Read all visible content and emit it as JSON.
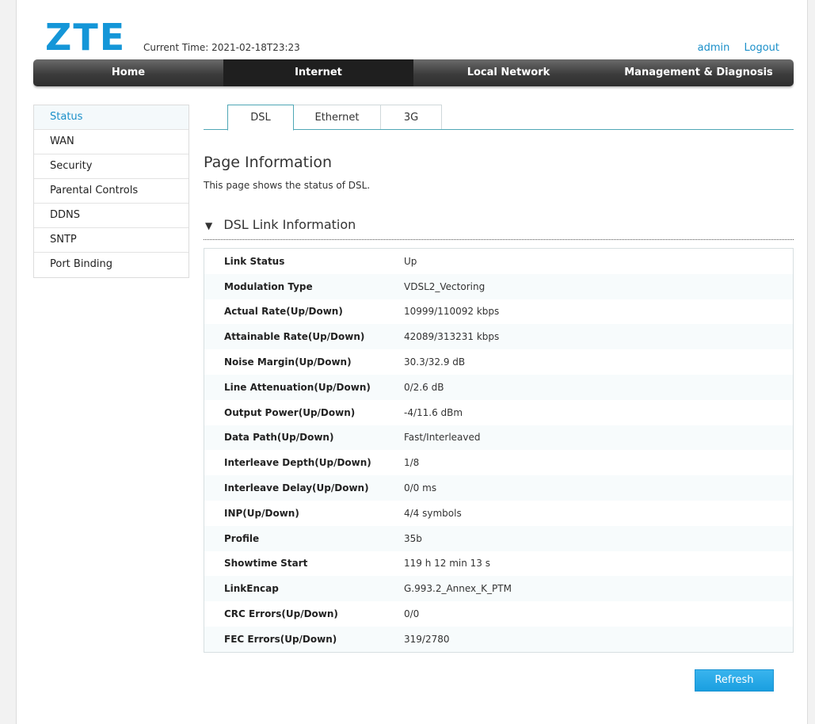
{
  "header": {
    "logo_text": "ZTE",
    "current_time_label": "Current Time:",
    "current_time_value": "2021-02-18T23:23",
    "user": "admin",
    "logout": "Logout"
  },
  "main_nav": [
    {
      "label": "Home",
      "active": false
    },
    {
      "label": "Internet",
      "active": true
    },
    {
      "label": "Local Network",
      "active": false
    },
    {
      "label": "Management & Diagnosis",
      "active": false
    }
  ],
  "sidebar": {
    "items": [
      {
        "label": "Status",
        "active": true
      },
      {
        "label": "WAN",
        "active": false
      },
      {
        "label": "Security",
        "active": false
      },
      {
        "label": "Parental Controls",
        "active": false
      },
      {
        "label": "DDNS",
        "active": false
      },
      {
        "label": "SNTP",
        "active": false
      },
      {
        "label": "Port Binding",
        "active": false
      }
    ]
  },
  "sub_tabs": [
    {
      "label": "DSL",
      "active": true
    },
    {
      "label": "Ethernet",
      "active": false
    },
    {
      "label": "3G",
      "active": false
    }
  ],
  "page_info": {
    "title": "Page Information",
    "description": "This page shows the status of DSL."
  },
  "dsl_section": {
    "title": "DSL Link Information",
    "rows": [
      {
        "label": "Link Status",
        "value": "Up"
      },
      {
        "label": "Modulation Type",
        "value": "VDSL2_Vectoring"
      },
      {
        "label": "Actual Rate(Up/Down)",
        "value": "10999/110092 kbps"
      },
      {
        "label": "Attainable Rate(Up/Down)",
        "value": "42089/313231 kbps"
      },
      {
        "label": "Noise Margin(Up/Down)",
        "value": "30.3/32.9 dB"
      },
      {
        "label": "Line Attenuation(Up/Down)",
        "value": "0/2.6 dB"
      },
      {
        "label": "Output Power(Up/Down)",
        "value": "-4/11.6 dBm"
      },
      {
        "label": "Data Path(Up/Down)",
        "value": "Fast/Interleaved"
      },
      {
        "label": "Interleave Depth(Up/Down)",
        "value": "1/8"
      },
      {
        "label": "Interleave Delay(Up/Down)",
        "value": "0/0 ms"
      },
      {
        "label": "INP(Up/Down)",
        "value": "4/4 symbols"
      },
      {
        "label": "Profile",
        "value": "35b"
      },
      {
        "label": "Showtime Start",
        "value": "119 h 12 min 13 s"
      },
      {
        "label": "LinkEncap",
        "value": "G.993.2_Annex_K_PTM"
      },
      {
        "label": "CRC Errors(Up/Down)",
        "value": "0/0"
      },
      {
        "label": "FEC Errors(Up/Down)",
        "value": "319/2780"
      }
    ]
  },
  "refresh_label": "Refresh",
  "colors": {
    "brand_blue": "#1496d8",
    "link_blue": "#1a8fc9",
    "button_blue": "#1a9fe0",
    "tab_border": "#4fa7b6"
  }
}
